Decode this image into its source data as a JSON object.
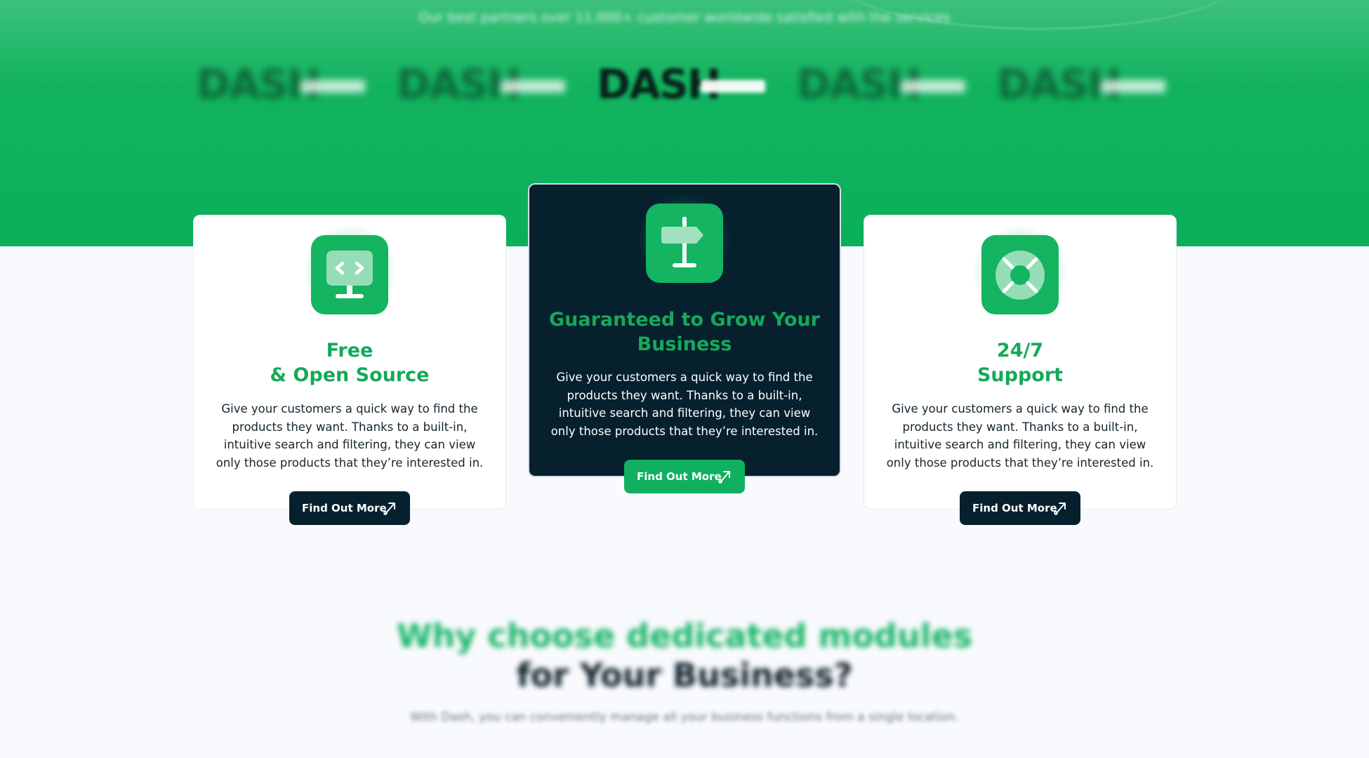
{
  "hero": {
    "trusted_text": "Our best partners over 11,000+ customer worldwide satisfied with the services",
    "logos": [
      {
        "mark": "DASH",
        "icon": "dash-logo"
      },
      {
        "mark": "DASH",
        "icon": "dash-logo"
      },
      {
        "mark": "DASH",
        "icon": "dash-logo"
      },
      {
        "mark": "DASH",
        "icon": "dash-logo"
      },
      {
        "mark": "DASH",
        "icon": "dash-logo"
      }
    ]
  },
  "colors": {
    "brand_green": "#14b461",
    "navy": "#06202e",
    "title_green": "#15a95a"
  },
  "cards": [
    {
      "title": "Free\n& Open Source",
      "body": "Give your customers a quick way to find the products they want. Thanks to a built-in, intuitive search and filtering, they can view only those products that they’re interested in.",
      "cta": "Find Out More",
      "icon": "monitor-code-icon"
    },
    {
      "title": "Guaranteed to Grow Your Business",
      "body": "Give your customers a quick way to find the products they want. Thanks to a built-in, intuitive search and filtering, they can view only those products that they’re interested in.",
      "cta": "Find Out More",
      "icon": "signpost-icon"
    },
    {
      "title": "24/7\nSupport",
      "body": "Give your customers a quick way to find the products they want. Thanks to a built-in, intuitive search and filtering, they can view only those products that they’re interested in.",
      "cta": "Find Out More",
      "icon": "lifebuoy-icon"
    }
  ],
  "why": {
    "title_line1": "Why choose dedicated modules",
    "title_line2": "for Your Business?",
    "subtitle": "With Dash, you can conveniently manage all your business functions from a single location."
  }
}
